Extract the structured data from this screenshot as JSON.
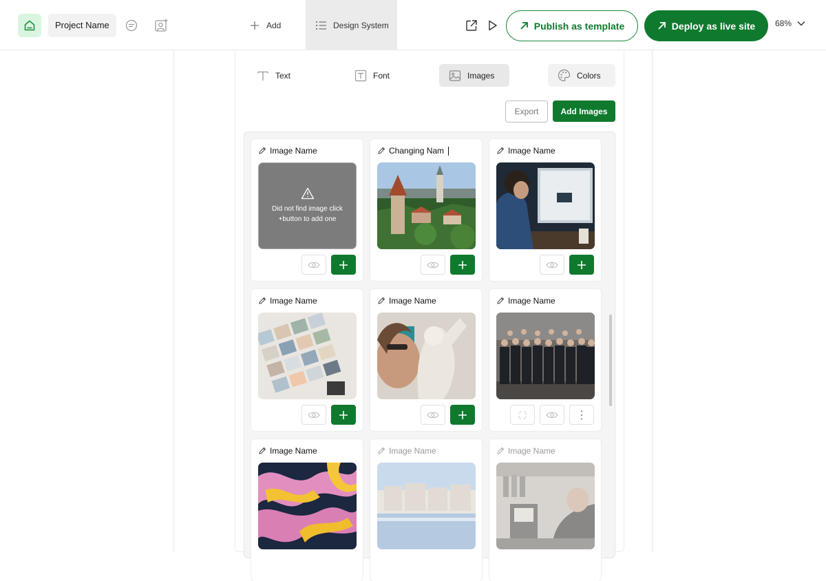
{
  "topbar": {
    "project_name": "Project Name",
    "add_label": "Add",
    "design_system_label": "Design System",
    "publish_label": "Publish as template",
    "deploy_label": "Deploy as live site",
    "zoom": "68%"
  },
  "tabs": [
    {
      "label": "Text",
      "icon": "text-icon"
    },
    {
      "label": "Font",
      "icon": "font-icon"
    },
    {
      "label": "Images",
      "icon": "image-icon",
      "active": true
    },
    {
      "label": "Colors",
      "icon": "palette-icon"
    }
  ],
  "toolbar": {
    "export_label": "Export",
    "add_images_label": "Add Images"
  },
  "cards": [
    {
      "name": "Image Name",
      "missing_text": "Did not find image click +button to add one"
    },
    {
      "name": "Changing Nam"
    },
    {
      "name": "Image Name"
    },
    {
      "name": "Image Name"
    },
    {
      "name": "Image Name"
    },
    {
      "name": "Image Name"
    },
    {
      "name": "Image Name"
    },
    {
      "name": "Image Name"
    },
    {
      "name": "Image Name"
    }
  ],
  "colors": {
    "accent": "#0f7a2e",
    "accent_light": "#d9f5df",
    "missing_bg": "#7c7c7c"
  }
}
